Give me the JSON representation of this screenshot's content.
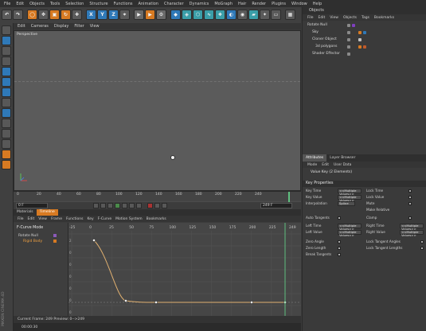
{
  "menubar": [
    "File",
    "Edit",
    "Objects",
    "Tools",
    "Selection",
    "Structure",
    "Functions",
    "Animation",
    "Character",
    "Dynamics",
    "MoGraph",
    "Hair",
    "Render",
    "Plugins",
    "Window",
    "Help"
  ],
  "viewport": {
    "menu": [
      "Edit",
      "Cameras",
      "Display",
      "Filter",
      "View"
    ],
    "label": "Perspective"
  },
  "ruler": {
    "ticks": [
      "0",
      "20",
      "40",
      "60",
      "80",
      "100",
      "120",
      "140",
      "160",
      "180",
      "200",
      "220",
      "240"
    ],
    "start_field": "0 F",
    "end_field": "249 F"
  },
  "timeline": {
    "tabs": [
      "Materials",
      "Timeline"
    ],
    "active_tab": "Timeline",
    "menu": [
      "File",
      "Edit",
      "View",
      "Frame",
      "Functions",
      "Key",
      "F-Curve",
      "Motion System",
      "Bookmarks"
    ],
    "mode_label": "F-Curve Mode",
    "tracks": [
      "Rotate Null",
      "Rigid Body"
    ],
    "graph_ticks": [
      "-25",
      "0",
      "25",
      "50",
      "75",
      "100",
      "125",
      "150",
      "175",
      "200",
      "225",
      "249"
    ],
    "graph_yticks": [
      "2",
      "0",
      "0",
      "0",
      "0",
      "0",
      "0"
    ],
    "status": "Current Frame: 249  Preview: 0-->249",
    "timecode": "00:00:30"
  },
  "objects": {
    "title": "Objects",
    "menu": [
      "File",
      "Edit",
      "View",
      "Objects",
      "Tags",
      "Bookmarks"
    ],
    "items": [
      "Rotate Null",
      "Sky",
      "Cloner Object",
      "3d polygons",
      "Shader Effector"
    ]
  },
  "attributes": {
    "tabs": [
      "Attributes",
      "Layer Browser"
    ],
    "menu": [
      "Mode",
      "Edit",
      "User Data"
    ],
    "header": "Value Key (2 Elements)",
    "section": "Key Properties",
    "rows_left": [
      {
        "label": "Key Time",
        "value": "<<Multiple Values>>"
      },
      {
        "label": "Key Value",
        "value": "<<Multiple Values>>"
      },
      {
        "label": "Interpolation",
        "value": "Spline"
      }
    ],
    "rows_right": [
      "Lock Time",
      "Lock Value",
      "Mute",
      "Make Relative",
      "Clamp"
    ],
    "auto_tangents": "Auto Tangents",
    "tangent_left": [
      {
        "label": "Left Time",
        "value": "<<Multiple Values>>"
      },
      {
        "label": "Left Value",
        "value": "<<Multiple Values>>"
      }
    ],
    "tangent_right": [
      {
        "label": "Right Time",
        "value": "<<Multiple Values>>"
      },
      {
        "label": "Right Value",
        "value": "<<Multiple Values>>"
      }
    ],
    "bottom_left": [
      "Zero Angle",
      "Zero Length",
      "Break Tangents"
    ],
    "bottom_right": [
      "Lock Tangent Angles",
      "Lock Tangent Lengths"
    ]
  },
  "branding": "MAXON CINEMA 4D",
  "colors": {
    "accent": "#d77a22",
    "curve": "#e0b070",
    "blue": "#2f79b8"
  }
}
